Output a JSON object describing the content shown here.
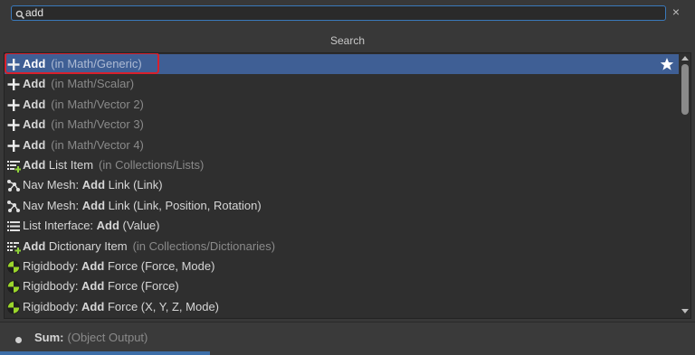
{
  "search": {
    "value": "add",
    "placeholder": ""
  },
  "clear_label": "×",
  "header": {
    "title": "Search"
  },
  "colors": {
    "selection": "#3f5f95",
    "accent_border": "#3a79bb",
    "highlight": "#d8202c",
    "rigidbody_green": "#9bd62b"
  },
  "items": [
    {
      "icon": "plus-icon",
      "pre": "",
      "bold": "Add",
      "post": "",
      "category": "(in Math/Generic)"
    },
    {
      "icon": "plus-icon",
      "pre": "",
      "bold": "Add",
      "post": "",
      "category": "(in Math/Scalar)"
    },
    {
      "icon": "plus-icon",
      "pre": "",
      "bold": "Add",
      "post": "",
      "category": "(in Math/Vector 2)"
    },
    {
      "icon": "plus-icon",
      "pre": "",
      "bold": "Add",
      "post": "",
      "category": "(in Math/Vector 3)"
    },
    {
      "icon": "plus-icon",
      "pre": "",
      "bold": "Add",
      "post": "",
      "category": "(in Math/Vector 4)"
    },
    {
      "icon": "list-add-icon",
      "pre": "",
      "bold": "Add",
      "post": " List Item",
      "category": "(in Collections/Lists)"
    },
    {
      "icon": "navmesh-icon",
      "pre": "Nav Mesh: ",
      "bold": "Add",
      "post": " Link (Link)",
      "category": ""
    },
    {
      "icon": "navmesh-icon",
      "pre": "Nav Mesh: ",
      "bold": "Add",
      "post": " Link (Link, Position, Rotation)",
      "category": ""
    },
    {
      "icon": "list-icon",
      "pre": "List Interface: ",
      "bold": "Add",
      "post": " (Value)",
      "category": ""
    },
    {
      "icon": "dictionary-add-icon",
      "pre": "",
      "bold": "Add",
      "post": " Dictionary Item",
      "category": "(in Collections/Dictionaries)"
    },
    {
      "icon": "rigidbody-icon",
      "pre": "Rigidbody: ",
      "bold": "Add",
      "post": " Force (Force, Mode)",
      "category": ""
    },
    {
      "icon": "rigidbody-icon",
      "pre": "Rigidbody: ",
      "bold": "Add",
      "post": " Force (Force)",
      "category": ""
    },
    {
      "icon": "rigidbody-icon",
      "pre": "Rigidbody: ",
      "bold": "Add",
      "post": " Force (X, Y, Z, Mode)",
      "category": ""
    }
  ],
  "footer": {
    "bold": "Sum:",
    "category": "(Object Output)"
  }
}
